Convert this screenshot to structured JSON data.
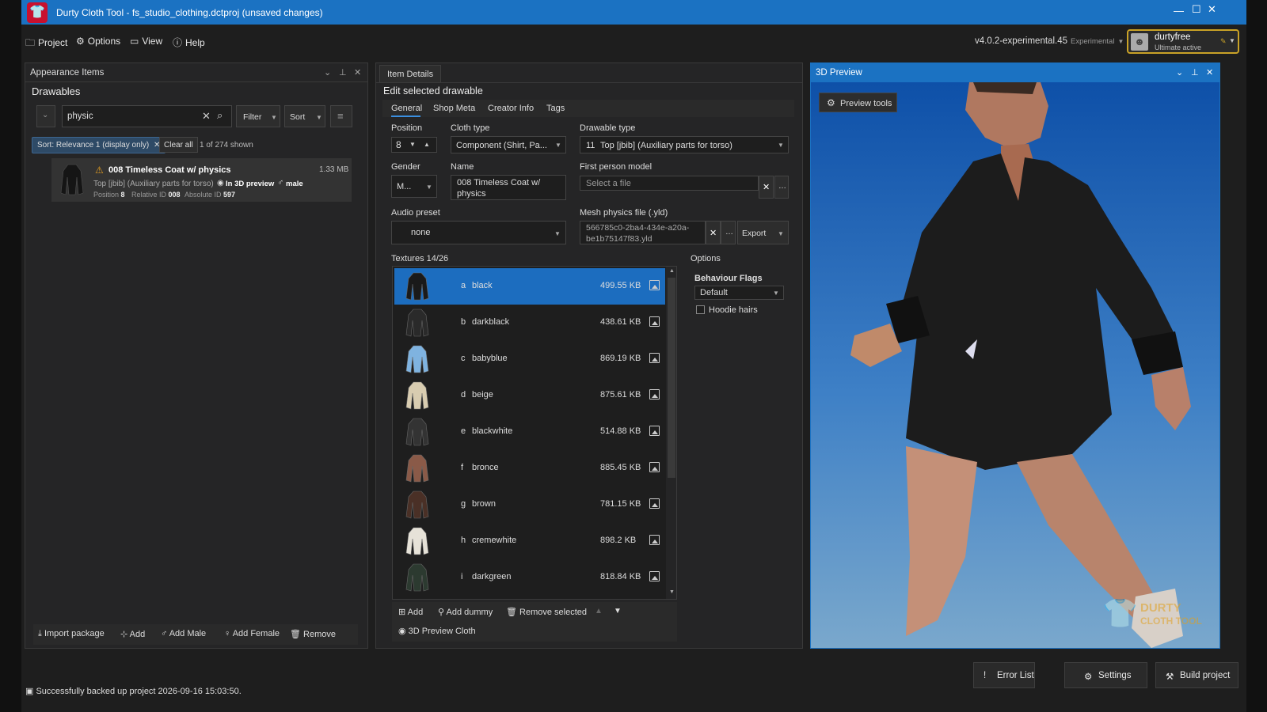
{
  "window": {
    "title": "Durty Cloth Tool - fs_studio_clothing.dctproj (unsaved changes)"
  },
  "menu": {
    "project": "Project",
    "options": "Options",
    "view": "View",
    "help": "Help"
  },
  "version": {
    "label": "v4.0.2-experimental.45",
    "channel": "Experimental"
  },
  "user": {
    "name": "durtyfree",
    "status": "Ultimate active"
  },
  "left_panel": {
    "title": "Appearance Items",
    "section": "Drawables",
    "search_value": "physic",
    "filter_label": "Filter",
    "sort_label": "Sort",
    "sort_chip": "Sort: Relevance 1 (display only)",
    "clear_all": "Clear all",
    "count": "1 of 274 shown",
    "item": {
      "name": "008 Timeless Coat w/ physics",
      "size": "1.33 MB",
      "type": "Top [jbib] (Auxiliary parts for torso)",
      "preview": "In 3D preview",
      "gender": "male",
      "position_label": "Position",
      "position": "8",
      "relative_label": "Relative ID",
      "relative": "008",
      "absolute_label": "Absolute ID",
      "absolute": "597"
    },
    "actions": {
      "import": "Import package",
      "add": "Add",
      "add_male": "Add Male",
      "add_female": "Add Female",
      "remove": "Remove"
    }
  },
  "details": {
    "tab": "Item Details",
    "heading": "Edit selected drawable",
    "tabs": [
      "General",
      "Shop Meta",
      "Creator Info",
      "Tags"
    ],
    "position_label": "Position",
    "position_value": "8",
    "cloth_type_label": "Cloth type",
    "cloth_type_value": "Component (Shirt, Pa...",
    "drawable_type_label": "Drawable type",
    "drawable_type_num": "11",
    "drawable_type_value": "Top [jbib] (Auxiliary parts for torso)",
    "gender_label": "Gender",
    "gender_value": "M...",
    "name_label": "Name",
    "name_line1": "008   Timeless   Coat   w/",
    "name_line2": "physics",
    "fp_label": "First person model",
    "fp_placeholder": "Select a file",
    "audio_label": "Audio preset",
    "audio_value": "none",
    "mesh_label": "Mesh physics file (.yld)",
    "mesh_line1": "566785c0-2ba4-434e-a20a-",
    "mesh_line2": "be1b75147f83.yld",
    "export": "Export",
    "textures_label": "Textures 14/26",
    "options_label": "Options",
    "behaviour_label": "Behaviour Flags",
    "behaviour_value": "Default",
    "hoodie_label": "Hoodie hairs",
    "textures": [
      {
        "letter": "a",
        "name": "black",
        "size": "499.55 KB",
        "color": "#1a1a1a"
      },
      {
        "letter": "b",
        "name": "darkblack",
        "size": "438.61 KB",
        "color": "#2a2a2a"
      },
      {
        "letter": "c",
        "name": "babyblue",
        "size": "869.19 KB",
        "color": "#7fb3e0"
      },
      {
        "letter": "d",
        "name": "beige",
        "size": "875.61 KB",
        "color": "#d8ccb0"
      },
      {
        "letter": "e",
        "name": "blackwhite",
        "size": "514.88 KB",
        "color": "#333333"
      },
      {
        "letter": "f",
        "name": "bronce",
        "size": "885.45 KB",
        "color": "#8a5a48"
      },
      {
        "letter": "g",
        "name": "brown",
        "size": "781.15 KB",
        "color": "#4a3026"
      },
      {
        "letter": "h",
        "name": "cremewhite",
        "size": "898.2 KB",
        "color": "#e6e2d8"
      },
      {
        "letter": "i",
        "name": "darkgreen",
        "size": "818.84 KB",
        "color": "#2c3a30"
      }
    ],
    "actions": {
      "add": "Add",
      "add_dummy": "Add dummy",
      "remove_selected": "Remove selected",
      "preview_cloth": "3D Preview Cloth"
    }
  },
  "preview": {
    "title": "3D Preview",
    "tools": "Preview tools",
    "watermark_line1": "DURTY",
    "watermark_line2": "CLOTH TOOL"
  },
  "status": {
    "message": "Successfully backed up project 2026-09-16 15:03:50.",
    "error_list": "Error List",
    "settings": "Settings",
    "build": "Build project"
  },
  "colors": {
    "accent": "#1b72c2",
    "selected_row": "#1c6dbf",
    "user_border": "#c9a227"
  }
}
